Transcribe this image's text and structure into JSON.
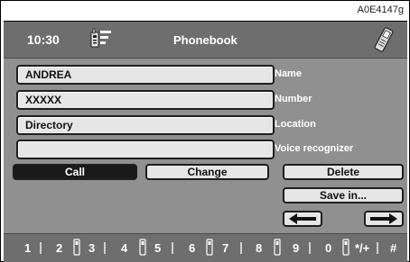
{
  "figure_code": "A0E4147g",
  "header": {
    "time": "10:30",
    "title": "Phonebook"
  },
  "entry": {
    "name_value": "ANDREA",
    "name_label": "Name",
    "number_value": "XXXXX",
    "number_label": "Number",
    "location_value": "Directory",
    "location_label": "Location",
    "voice_value": "",
    "voice_label": "Voice recognizer"
  },
  "buttons": {
    "call": "Call",
    "change": "Change",
    "delete": "Delete",
    "save_in": "Save in..."
  },
  "keypad": [
    "1",
    "2",
    "3",
    "4",
    "5",
    "6",
    "7",
    "8",
    "9",
    "0",
    "*/+",
    "#"
  ],
  "colors": {
    "screen": "#909090",
    "bars": "#6e6e6e",
    "field": "#e6e6e6",
    "active": "#1a1a1a"
  }
}
